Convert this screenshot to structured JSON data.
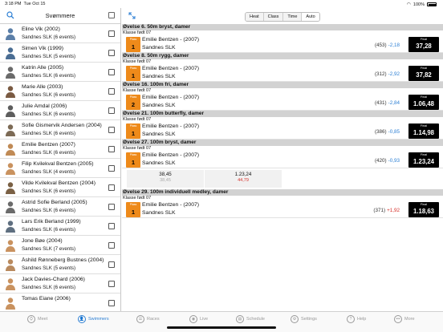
{
  "status": {
    "time": "3:18 PM",
    "date": "Tue Oct 15",
    "battery": "100%"
  },
  "left": {
    "title": "Svømmere",
    "swimmers": [
      {
        "name": "Eline Vik (2002)",
        "club": "Sandnes SLK (6 events)"
      },
      {
        "name": "Simen Vik (1999)",
        "club": "Sandnes SLK (5 events)"
      },
      {
        "name": "Katrin Alle (2005)",
        "club": "Sandnes SLK (6 events)"
      },
      {
        "name": "Marie Alle (2003)",
        "club": "Sandnes SLK (6 events)"
      },
      {
        "name": "Julie Amdal (2006)",
        "club": "Sandnes SLK (6 events)"
      },
      {
        "name": "Sofie Gismervik Andersen (2004)",
        "club": "Sandnes SLK (6 events)"
      },
      {
        "name": "Emilie Bentzen (2007)",
        "club": "Sandnes SLK (6 events)"
      },
      {
        "name": "Filip Kvilekval Bentzen (2005)",
        "club": "Sandnes SLK (4 events)"
      },
      {
        "name": "Vilde Kvilekval Bentzen (2004)",
        "club": "Sandnes SLK (6 events)"
      },
      {
        "name": "Astrid Sofie Berland (2005)",
        "club": "Sandnes SLK (6 events)"
      },
      {
        "name": "Lars Erik Berland (1999)",
        "club": "Sandnes SLK (6 events)"
      },
      {
        "name": "Jone Bøe (2004)",
        "club": "Sandnes SLK (7 events)"
      },
      {
        "name": "Åshild Rønneberg Bustnes (2004)",
        "club": "Sandnes SLK (5 events)"
      },
      {
        "name": "Jack Davies-Chard (2006)",
        "club": "Sandnes SLK (6 events)"
      },
      {
        "name": "Tomas Eiane (2006)",
        "club": ""
      }
    ]
  },
  "segment": [
    "Heat",
    "Class",
    "Time",
    "Auto"
  ],
  "events": [
    {
      "title": "Øvelse 6. 50m bryst, damer",
      "class": "Klasse født 07",
      "place": "1",
      "name": "Emilie Bentzen - (2007)",
      "club": "Sandnes SLK",
      "points": "(453)",
      "diff": "-2,18",
      "diff_color": "blue",
      "time": "37,28"
    },
    {
      "title": "Øvelse 8. 50m rygg, damer",
      "class": "Klasse født 07",
      "place": "1",
      "name": "Emilie Bentzen - (2007)",
      "club": "Sandnes SLK",
      "points": "(312)",
      "diff": "-2,92",
      "diff_color": "blue",
      "time": "37,82"
    },
    {
      "title": "Øvelse 16. 100m fri, damer",
      "class": "Klasse født 07",
      "place": "2",
      "name": "Emilie Bentzen - (2007)",
      "club": "Sandnes SLK",
      "points": "(431)",
      "diff": "-2,84",
      "diff_color": "blue",
      "time": "1.06,48"
    },
    {
      "title": "Øvelse 21. 100m butterfly, damer",
      "class": "Klasse født 07",
      "place": "1",
      "name": "Emilie Bentzen - (2007)",
      "club": "Sandnes SLK",
      "points": "(386)",
      "diff": "-0,85",
      "diff_color": "blue",
      "time": "1.14,98"
    },
    {
      "title": "Øvelse 27. 100m bryst, damer",
      "class": "Klasse født 07",
      "place": "1",
      "name": "Emilie Bentzen - (2007)",
      "club": "Sandnes SLK",
      "points": "(420)",
      "diff": "-0,93",
      "diff_color": "blue",
      "time": "1.23,24",
      "splits": [
        {
          "a": "38,45",
          "b": "38,45",
          "b_red": false
        },
        {
          "a": "1.23,24",
          "b": "44,79",
          "b_red": true
        }
      ]
    },
    {
      "title": "Øvelse 29. 100m individuell medley, damer",
      "class": "Klasse født 07",
      "place": "1",
      "name": "Emilie Bentzen - (2007)",
      "club": "Sandnes SLK",
      "points": "(371)",
      "diff": "+1,92",
      "diff_color": "red",
      "time": "1.18,63"
    }
  ],
  "labels": {
    "place": "Plass",
    "final": "Final"
  },
  "tabs": [
    {
      "label": "Meet",
      "icon": "meet-icon",
      "active": false
    },
    {
      "label": "Swimmers",
      "icon": "swimmers-icon",
      "active": true
    },
    {
      "label": "Races",
      "icon": "races-icon",
      "active": false
    },
    {
      "label": "Live",
      "icon": "live-icon",
      "active": false
    },
    {
      "label": "Schedule",
      "icon": "schedule-icon",
      "active": false
    },
    {
      "label": "Settings",
      "icon": "settings-icon",
      "active": false
    },
    {
      "label": "Help",
      "icon": "help-icon",
      "active": false
    },
    {
      "label": "More",
      "icon": "more-icon",
      "active": false
    }
  ],
  "colors": {
    "accent": "#2c7fd4",
    "place": "#ee8a1a",
    "final": "#000000",
    "negative": "#d6302a"
  }
}
